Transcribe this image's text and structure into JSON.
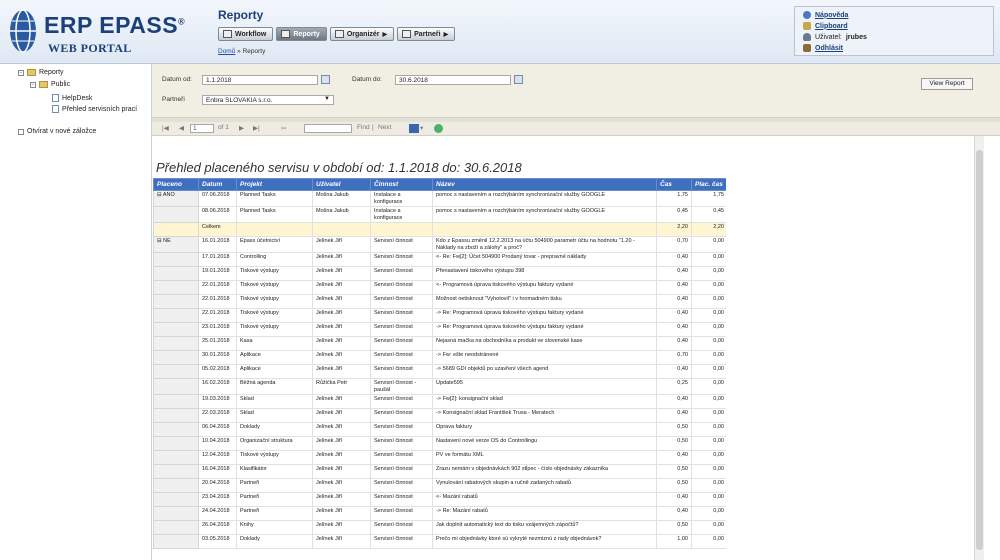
{
  "header": {
    "logo": "ERP EPASS",
    "logo_reg": "®",
    "logo_sub": "WEB PORTAL",
    "title": "Reporty",
    "menu": [
      {
        "label": "Workflow",
        "icon": "workflow-icon",
        "active": false,
        "arrow": false
      },
      {
        "label": "Reporty",
        "icon": "report-icon",
        "active": true,
        "arrow": false
      },
      {
        "label": "Organizér",
        "icon": "organizer-icon",
        "active": false,
        "arrow": true
      },
      {
        "label": "Partneři",
        "icon": "partners-icon",
        "active": false,
        "arrow": true
      }
    ],
    "breadcrumb_home": "Domů",
    "breadcrumb_sep": " » ",
    "breadcrumb_current": "Reporty",
    "user_panel": {
      "help": "Nápověda",
      "clipboard": "Clipboard",
      "user_prefix": "Uživatel:",
      "user_name": "jrubes",
      "logout": "Odhlásit"
    }
  },
  "tree": {
    "root": "Reporty",
    "folder": "Public",
    "items": [
      "HelpDesk",
      "Přehled servisních prací"
    ],
    "checkbox_label": "Otvírat v nové záložce"
  },
  "params": {
    "date_from_label": "Datum od:",
    "date_from": "1.1.2018",
    "date_to_label": "Datum do:",
    "date_to": "30.6.2018",
    "partner_label": "Partneři",
    "partner": "Enbra SLOVAKIA s.r.o.",
    "view_report": "View Report"
  },
  "toolbar": {
    "page": "1",
    "of": "of 1",
    "find": "Find",
    "next": "Next"
  },
  "report": {
    "title": "Přehled placeného servisu v období od: 1.1.2018 do: 30.6.2018",
    "columns": [
      "Placeno",
      "Datum",
      "Projekt",
      "Uživatel",
      "Činnost",
      "Název",
      "Čas",
      "Plac. čas"
    ],
    "rows": [
      {
        "g": "⊟ ANO",
        "d": "07.06.2018",
        "p": "Planned Tasks",
        "u": "Mošna Jakub",
        "c": "Instalace a konfigurace",
        "n": "pomoc s nastavením a rozchýbáním synchronizační služby GOOGLE",
        "t": "1,75",
        "pt": "1,75"
      },
      {
        "g": "",
        "d": "08.06.2018",
        "p": "Planned Tasks",
        "u": "Mošna Jakub",
        "c": "Instalace a konfigurace",
        "n": "pomoc s nastavením a rozchýbáním synchronizační služby GOOGLE",
        "t": "0,45",
        "pt": "0,45"
      },
      {
        "g": "",
        "d": "Celkem",
        "p": "",
        "u": "",
        "c": "",
        "n": "",
        "t": "2,20",
        "pt": "2,20",
        "total": true
      },
      {
        "g": "⊟ NE",
        "d": "16.01.2018",
        "p": "Epass účetnictví",
        "u": "Jelínek Jiří",
        "c": "Servisní činnost",
        "n": "Kdo z Epassu změnil 12.2.2013 na účtu 504900 parametr účtu na hodnotu \"1.20 - Náklady na zboží a zálohy\" a proč?",
        "t": "0,70",
        "pt": "0,00"
      },
      {
        "g": "",
        "d": "17.01.2018",
        "p": "Controlling",
        "u": "Jelínek Jiří",
        "c": "Servisní činnost",
        "n": "<- Re: Fw[2]: Účet 504900 Prodaný tovar - prepravné náklady",
        "t": "0,40",
        "pt": "0,00"
      },
      {
        "g": "",
        "d": "19.01.2018",
        "p": "Tiskové výstupy",
        "u": "Jelínek Jiří",
        "c": "Servisní činnost",
        "n": "Přenastavení tiskového výstupu 398",
        "t": "0,40",
        "pt": "0,00"
      },
      {
        "g": "",
        "d": "22.01.2018",
        "p": "Tiskové výstupy",
        "u": "Jelínek Jiří",
        "c": "Servisní činnost",
        "n": "<- Programová úprava tiskového výstupu faktury vydané",
        "t": "0,40",
        "pt": "0,00"
      },
      {
        "g": "",
        "d": "22.01.2018",
        "p": "Tiskové výstupy",
        "u": "Jelínek Jiří",
        "c": "Servisní činnost",
        "n": "Možnost netisknout \"Vyhotovil\" i v hromadném tisku",
        "t": "0,40",
        "pt": "0,00"
      },
      {
        "g": "",
        "d": "22.01.2018",
        "p": "Tiskové výstupy",
        "u": "Jelínek Jiří",
        "c": "Servisní činnost",
        "n": "-> Re: Programová úprava tiskového výstupu faktury vydané",
        "t": "0,40",
        "pt": "0,00"
      },
      {
        "g": "",
        "d": "23.01.2018",
        "p": "Tiskové výstupy",
        "u": "Jelínek Jiří",
        "c": "Servisní činnost",
        "n": "-> Re: Programová úprava tiskového výstupu faktury vydané",
        "t": "0,40",
        "pt": "0,00"
      },
      {
        "g": "",
        "d": "25.01.2018",
        "p": "Kasa",
        "u": "Jelínek Jiří",
        "c": "Servisní činnost",
        "n": "Nejasná mačka na obchodníka a produkt ve slovenské kase",
        "t": "0,40",
        "pt": "0,00"
      },
      {
        "g": "",
        "d": "30.01.2018",
        "p": "Aplikace",
        "u": "Jelínek Jiří",
        "c": "Servisní činnost",
        "n": "-> Fw: ešte neodstránené",
        "t": "0,70",
        "pt": "0,00"
      },
      {
        "g": "",
        "d": "05.02.2018",
        "p": "Aplikace",
        "u": "Jelínek Jiří",
        "c": "Servisní činnost",
        "n": "-> 5689 GDI objektů po uzavření všech agend",
        "t": "0,40",
        "pt": "0,00"
      },
      {
        "g": "",
        "d": "16.02.2018",
        "p": "Běžná agenda",
        "u": "Růžička Petr",
        "c": "Servisní činnost - paušál",
        "n": "Update595",
        "t": "0,25",
        "pt": "0,00"
      },
      {
        "g": "",
        "d": "19.03.2018",
        "p": "Sklad",
        "u": "Jelínek Jiří",
        "c": "Servisní činnost",
        "n": "-> Fw[2]: konsignační sklad",
        "t": "0,40",
        "pt": "0,00"
      },
      {
        "g": "",
        "d": "22.03.2018",
        "p": "Sklad",
        "u": "Jelínek Jiří",
        "c": "Servisní činnost",
        "n": "-> Konsignační sklad František Trusa - Meratech",
        "t": "0,40",
        "pt": "0,00"
      },
      {
        "g": "",
        "d": "06.04.2018",
        "p": "Doklady",
        "u": "Jelínek Jiří",
        "c": "Servisní činnost",
        "n": "Oprava faktury",
        "t": "0,50",
        "pt": "0,00"
      },
      {
        "g": "",
        "d": "10.04.2018",
        "p": "Organizační struktura",
        "u": "Jelínek Jiří",
        "c": "Servisní činnost",
        "n": "Nastavení nové verze OS do Controllingu",
        "t": "0,50",
        "pt": "0,00"
      },
      {
        "g": "",
        "d": "12.04.2018",
        "p": "Tiskové výstupy",
        "u": "Jelínek Jiří",
        "c": "Servisní činnost",
        "n": "PV ve formátu XML",
        "t": "0,40",
        "pt": "0,00"
      },
      {
        "g": "",
        "d": "16.04.2018",
        "p": "Klasifikátor",
        "u": "Jelínek Jiří",
        "c": "Servisní činnost",
        "n": "Zrazu nemám v objednávkách 902 stĺpec - číslo objednávky zákazníka",
        "t": "0,50",
        "pt": "0,00"
      },
      {
        "g": "",
        "d": "20.04.2018",
        "p": "Partneři",
        "u": "Jelínek Jiří",
        "c": "Servisní činnost",
        "n": "Vynulování rabatových skupin a ručně zadaných rabatů",
        "t": "0,50",
        "pt": "0,00"
      },
      {
        "g": "",
        "d": "23.04.2018",
        "p": "Partneři",
        "u": "Jelínek Jiří",
        "c": "Servisní činnost",
        "n": "<- Mazání rabatů",
        "t": "0,40",
        "pt": "0,00"
      },
      {
        "g": "",
        "d": "24.04.2018",
        "p": "Partneři",
        "u": "Jelínek Jiří",
        "c": "Servisní činnost",
        "n": "-> Re: Mazání rabatů",
        "t": "0,40",
        "pt": "0,00"
      },
      {
        "g": "",
        "d": "26.04.2018",
        "p": "Knihy",
        "u": "Jelínek Jiří",
        "c": "Servisní činnost",
        "n": "Jak doplnit automatický text do tisku vzájemných zápočtů?",
        "t": "0,50",
        "pt": "0,00"
      },
      {
        "g": "",
        "d": "03.05.2018",
        "p": "Doklady",
        "u": "Jelínek Jiří",
        "c": "Servisní činnost",
        "n": "Prečo mi objednávky ktoré sú vykryté nezmiznú z rady objednávok?",
        "t": "1,00",
        "pt": "0,00"
      }
    ]
  }
}
